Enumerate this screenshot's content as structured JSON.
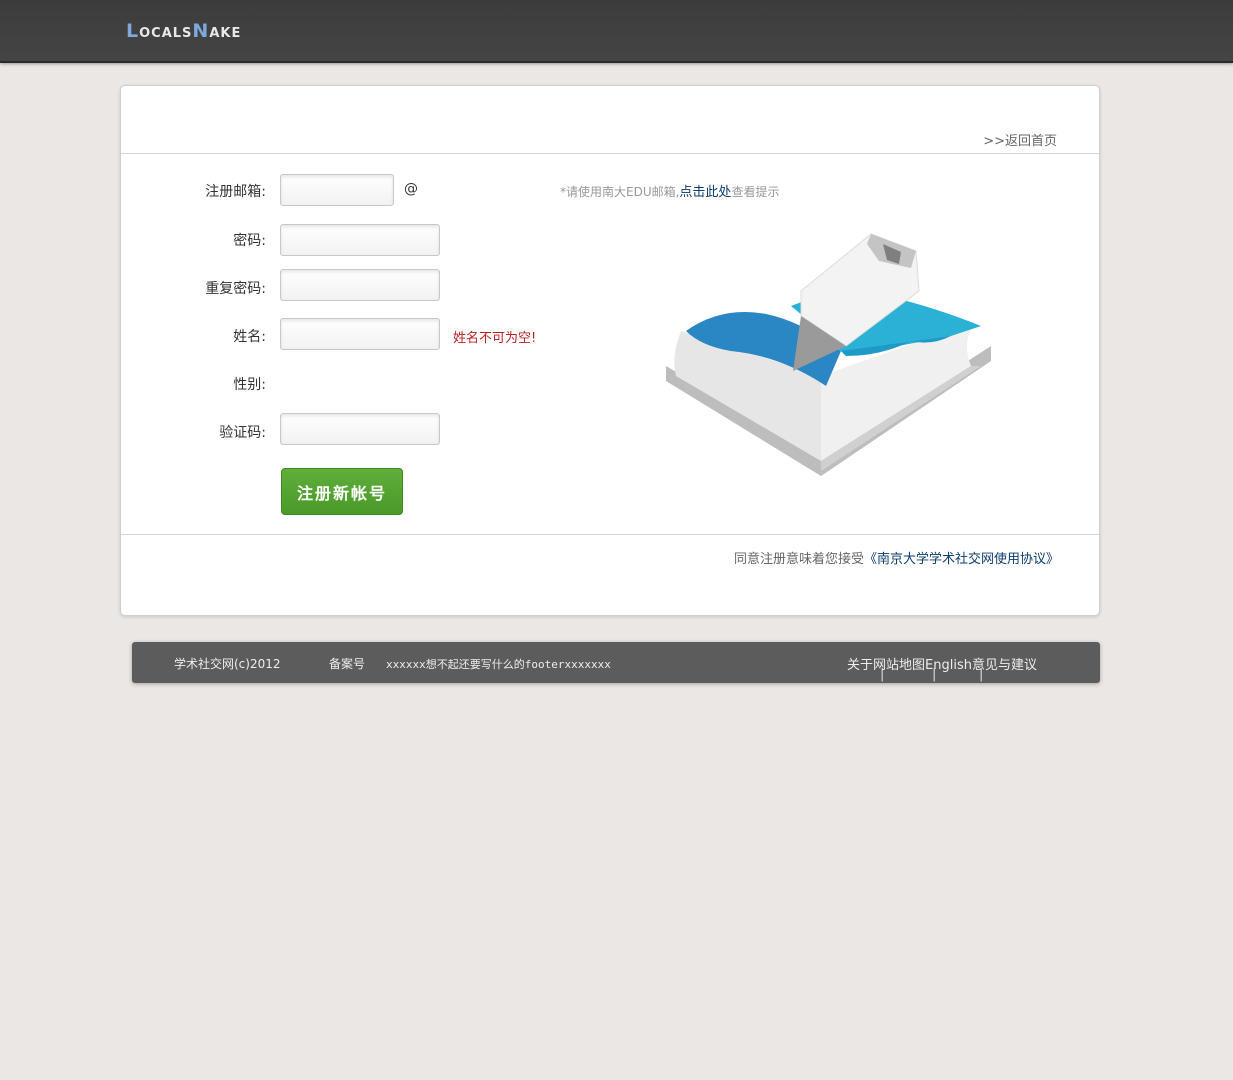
{
  "header": {
    "logo_first": "L",
    "logo_rest1": "ocals",
    "logo_accent": "N",
    "logo_rest2": "ake"
  },
  "card": {
    "back_link": ">>返回首页"
  },
  "form": {
    "email_label": "注册邮箱:",
    "email_value": "",
    "at_sign": "@",
    "hint_prefix": "*请使用南大EDU邮箱,",
    "hint_link": "点击此处",
    "hint_suffix": "查看提示",
    "password_label": "密码:",
    "repeat_password_label": "重复密码:",
    "name_label": "姓名:",
    "name_error": "姓名不可为空!",
    "gender_label": "性别:",
    "captcha_label": "验证码:",
    "submit_label": "注册新帐号"
  },
  "agreement": {
    "prefix": "同意注册意味着您接受",
    "link": "《南京大学学术社交网使用协议》"
  },
  "footer": {
    "copyright": "学术社交网(c)2012",
    "record": "备案号",
    "note": "xxxxxx想不起还要写什么的footerxxxxxxx",
    "links": [
      "关于",
      "网站地图",
      "English",
      "意见与建议"
    ]
  },
  "colors": {
    "accent": "#5fae3a",
    "link": "#0b3d6e",
    "error": "#bb2222"
  }
}
